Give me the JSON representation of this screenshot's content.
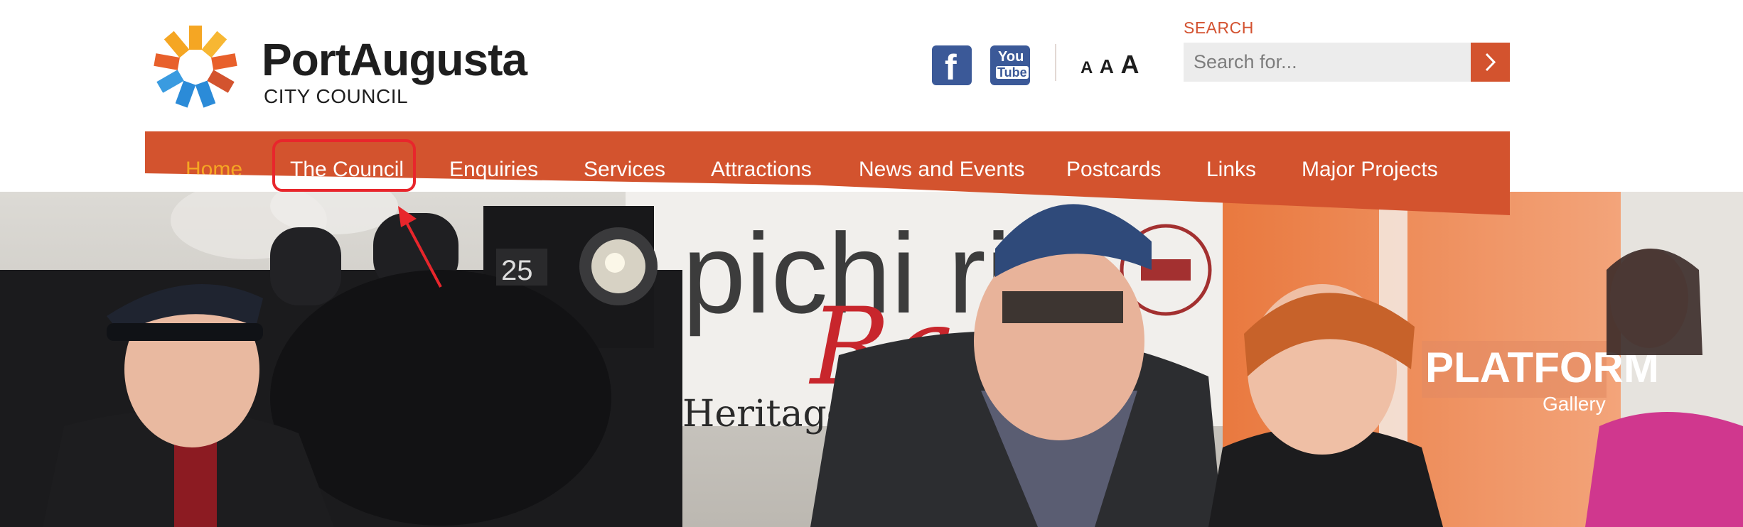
{
  "site": {
    "logo_title": "PortAugusta",
    "logo_subtitle": "CITY COUNCIL"
  },
  "social": [
    {
      "name": "facebook-icon",
      "glyph": "f"
    },
    {
      "name": "youtube-icon",
      "glyph_top": "You",
      "glyph_bottom": "Tube"
    }
  ],
  "text_size": {
    "small": "A",
    "medium": "A",
    "large": "A"
  },
  "search": {
    "label": "SEARCH",
    "placeholder": "Search for..."
  },
  "nav": {
    "items": [
      {
        "label": "Home",
        "active": true
      },
      {
        "label": "The Council",
        "active": false
      },
      {
        "label": "Enquiries",
        "active": false
      },
      {
        "label": "Services",
        "active": false
      },
      {
        "label": "Attractions",
        "active": false
      },
      {
        "label": "News and Events",
        "active": false
      },
      {
        "label": "Postcards",
        "active": false
      },
      {
        "label": "Links",
        "active": false
      },
      {
        "label": "Major Projects",
        "active": false
      }
    ]
  },
  "banner": {
    "locomotive_number": "25",
    "signage_main": "pichi ric",
    "signage_script": "Ra",
    "signage_sub": "Heritage Ste",
    "platform_sign": "PLATFORM",
    "platform_sub": "Gallery"
  },
  "colors": {
    "brand_orange": "#d3532e",
    "nav_active": "#f5a623",
    "annotation_red": "#e8262c",
    "social_blue": "#3b5998"
  }
}
